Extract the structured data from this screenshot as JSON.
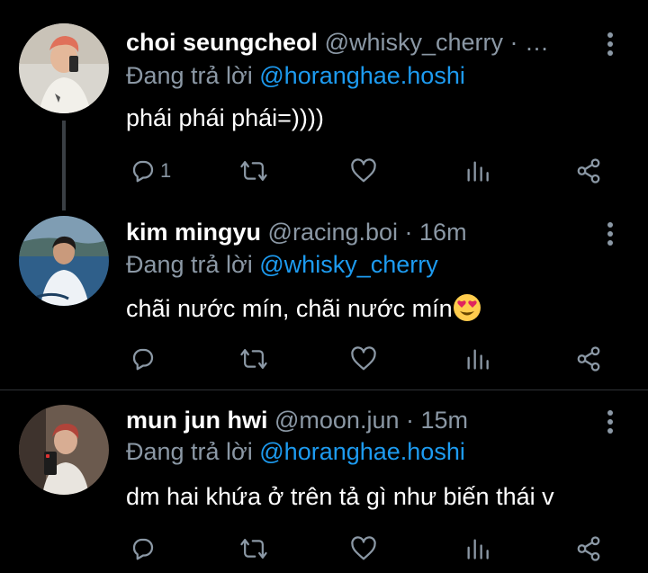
{
  "tweets": [
    {
      "name": "choi seungcheol",
      "handle": "@whisky_cherry",
      "time": "· …",
      "reply_prefix": "Đang trả lời ",
      "reply_to": "@horanghae.hoshi",
      "text": "phái phái phái=))))",
      "reply_count": "1"
    },
    {
      "name": "kim mingyu",
      "handle": "@racing.boi",
      "time": "· 16m",
      "reply_prefix": "Đang trả lời ",
      "reply_to": "@whisky_cherry",
      "text": "chãi nước mín, chãi nước mín",
      "reply_count": ""
    },
    {
      "name": "mun jun hwi",
      "handle": "@moon.jun",
      "time": "· 15m",
      "reply_prefix": "Đang trả lời ",
      "reply_to": "@horanghae.hoshi",
      "text": "dm hai khứa ở trên tả gì như biến thái v",
      "reply_count": ""
    }
  ],
  "colors": {
    "background": "#000000",
    "secondary_text": "#8b98a5",
    "mention": "#1d9bf0",
    "divider": "#2f3336"
  },
  "icons": [
    "reply-icon",
    "retweet-icon",
    "like-icon",
    "views-icon",
    "share-icon",
    "more-icon",
    "heart-eyes-emoji"
  ]
}
